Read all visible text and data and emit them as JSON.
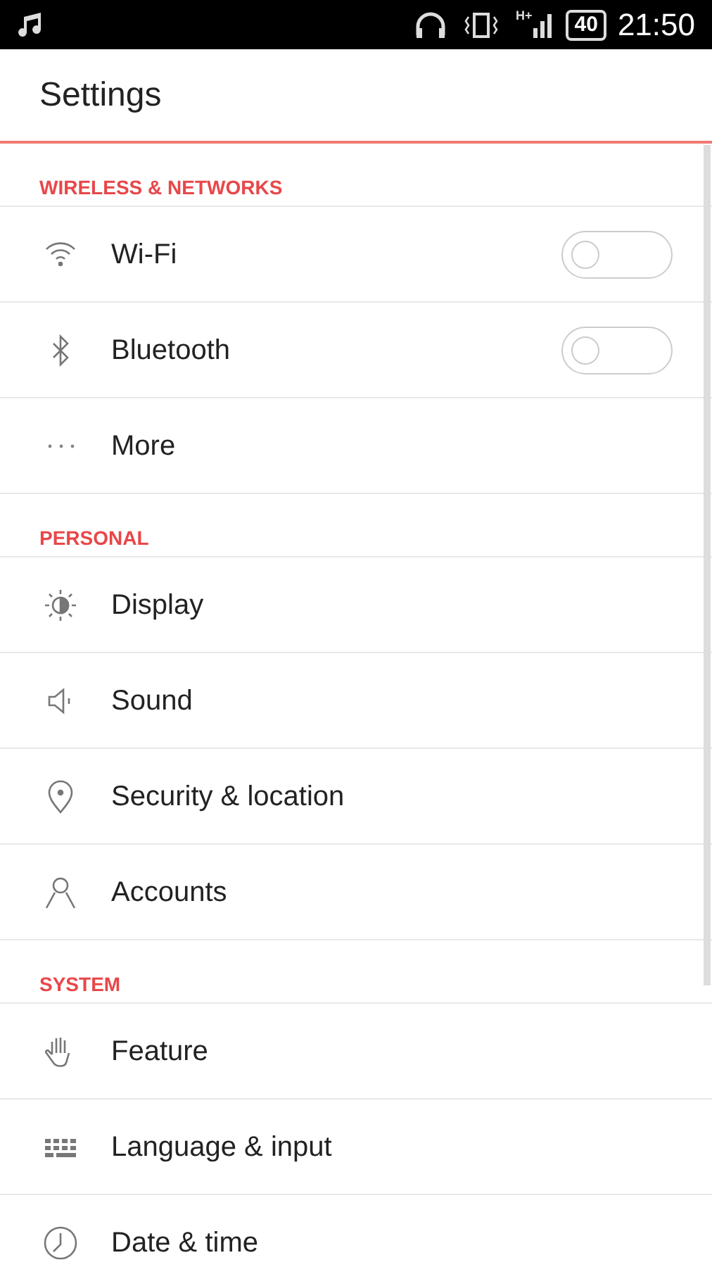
{
  "status_bar": {
    "network": "H+",
    "battery": "40",
    "time": "21:50"
  },
  "app_bar": {
    "title": "Settings"
  },
  "sections": [
    {
      "title": "WIRELESS & NETWORKS",
      "items": [
        {
          "label": "Wi-Fi",
          "kind": "toggle",
          "on": false
        },
        {
          "label": "Bluetooth",
          "kind": "toggle",
          "on": false
        },
        {
          "label": "More",
          "kind": "plain"
        }
      ]
    },
    {
      "title": "PERSONAL",
      "items": [
        {
          "label": "Display",
          "kind": "plain"
        },
        {
          "label": "Sound",
          "kind": "plain"
        },
        {
          "label": "Security & location",
          "kind": "plain"
        },
        {
          "label": "Accounts",
          "kind": "plain"
        }
      ]
    },
    {
      "title": "SYSTEM",
      "items": [
        {
          "label": "Feature",
          "kind": "plain"
        },
        {
          "label": "Language & input",
          "kind": "plain"
        },
        {
          "label": "Date & time",
          "kind": "plain"
        }
      ]
    }
  ]
}
